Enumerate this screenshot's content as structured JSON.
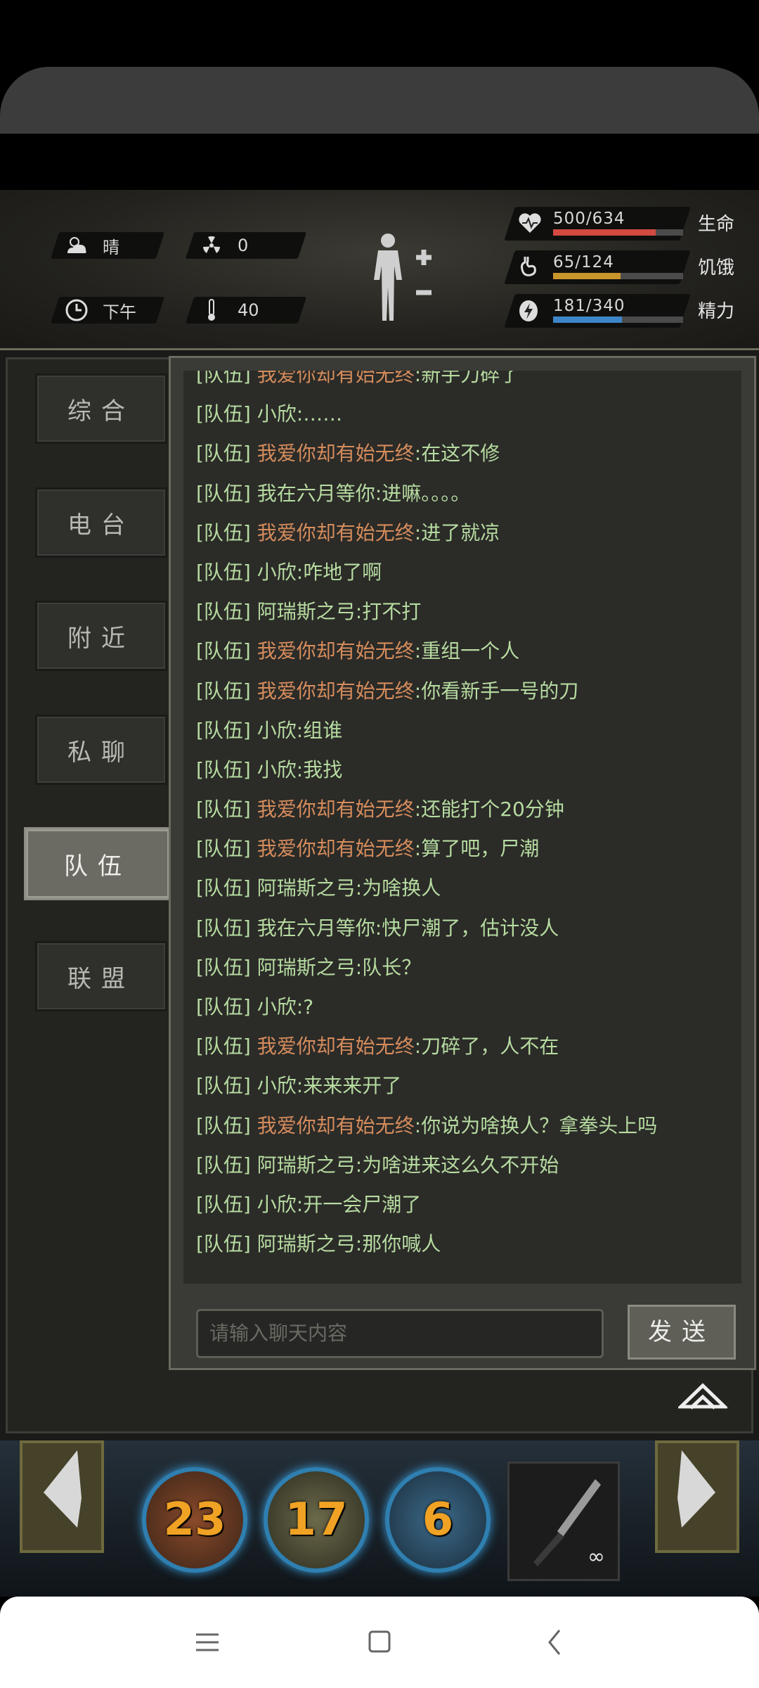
{
  "status": {
    "weather": "晴",
    "radiation": "0",
    "time": "下午",
    "temperature": "40",
    "bars": [
      {
        "value": "500/634",
        "label": "生命",
        "fraction": 0.79,
        "color": "#d24a40",
        "icon": "heart-pulse-icon"
      },
      {
        "value": "65/124",
        "label": "饥饿",
        "fraction": 0.52,
        "color": "#c9962c",
        "icon": "stomach-icon"
      },
      {
        "value": "181/340",
        "label": "精力",
        "fraction": 0.53,
        "color": "#3c86c8",
        "icon": "energy-icon"
      }
    ]
  },
  "tabs": [
    "综合",
    "电台",
    "附近",
    "私聊",
    "队伍",
    "联盟"
  ],
  "active_tab": "队伍",
  "chat": {
    "messages": [
      {
        "channel": "[队伍]",
        "sender": "我爱你却有始无终",
        "orange": true,
        "text": ":新手刀碎了"
      },
      {
        "channel": "[队伍]",
        "sender": "小欣",
        "orange": false,
        "text": ":……"
      },
      {
        "channel": "[队伍]",
        "sender": "我爱你却有始无终",
        "orange": true,
        "text": ":在这不修"
      },
      {
        "channel": "[队伍]",
        "sender": "我在六月等你",
        "orange": false,
        "text": ":进嘛。。。。"
      },
      {
        "channel": "[队伍]",
        "sender": "我爱你却有始无终",
        "orange": true,
        "text": ":进了就凉"
      },
      {
        "channel": "[队伍]",
        "sender": "小欣",
        "orange": false,
        "text": ":咋地了啊"
      },
      {
        "channel": "[队伍]",
        "sender": "阿瑞斯之弓",
        "orange": false,
        "text": ":打不打"
      },
      {
        "channel": "[队伍]",
        "sender": "我爱你却有始无终",
        "orange": true,
        "text": ":重组一个人"
      },
      {
        "channel": "[队伍]",
        "sender": "我爱你却有始无终",
        "orange": true,
        "text": ":你看新手一号的刀"
      },
      {
        "channel": "[队伍]",
        "sender": "小欣",
        "orange": false,
        "text": ":组谁"
      },
      {
        "channel": "[队伍]",
        "sender": "小欣",
        "orange": false,
        "text": ":我找"
      },
      {
        "channel": "[队伍]",
        "sender": "我爱你却有始无终",
        "orange": true,
        "text": ":还能打个20分钟"
      },
      {
        "channel": "[队伍]",
        "sender": "我爱你却有始无终",
        "orange": true,
        "text": ":算了吧，尸潮"
      },
      {
        "channel": "[队伍]",
        "sender": "阿瑞斯之弓",
        "orange": false,
        "text": ":为啥换人"
      },
      {
        "channel": "[队伍]",
        "sender": "我在六月等你",
        "orange": false,
        "text": ":快尸潮了，估计没人"
      },
      {
        "channel": "[队伍]",
        "sender": "阿瑞斯之弓",
        "orange": false,
        "text": ":队长？"
      },
      {
        "channel": "[队伍]",
        "sender": "小欣",
        "orange": false,
        "text": ":?"
      },
      {
        "channel": "[队伍]",
        "sender": "我爱你却有始无终",
        "orange": true,
        "text": ":刀碎了，人不在"
      },
      {
        "channel": "[队伍]",
        "sender": "小欣",
        "orange": false,
        "text": ":来来来开了"
      },
      {
        "channel": "[队伍]",
        "sender": "我爱你却有始无终",
        "orange": true,
        "text": ":你说为啥换人？拿拳头上吗"
      },
      {
        "channel": "[队伍]",
        "sender": "阿瑞斯之弓",
        "orange": false,
        "text": ":为啥进来这么久不开始"
      },
      {
        "channel": "[队伍]",
        "sender": "小欣",
        "orange": false,
        "text": ":开一会尸潮了"
      },
      {
        "channel": "[队伍]",
        "sender": "阿瑞斯之弓",
        "orange": false,
        "text": ":那你喊人"
      }
    ],
    "input_placeholder": "请输入聊天内容",
    "send_label": "发送"
  },
  "skills": [
    {
      "count": "23",
      "icon": "rage-skill-icon"
    },
    {
      "count": "17",
      "icon": "heal-skill-icon"
    },
    {
      "count": "6",
      "icon": "sprint-skill-icon"
    }
  ],
  "weapon": {
    "icon": "knife-icon",
    "durability": "∞"
  }
}
